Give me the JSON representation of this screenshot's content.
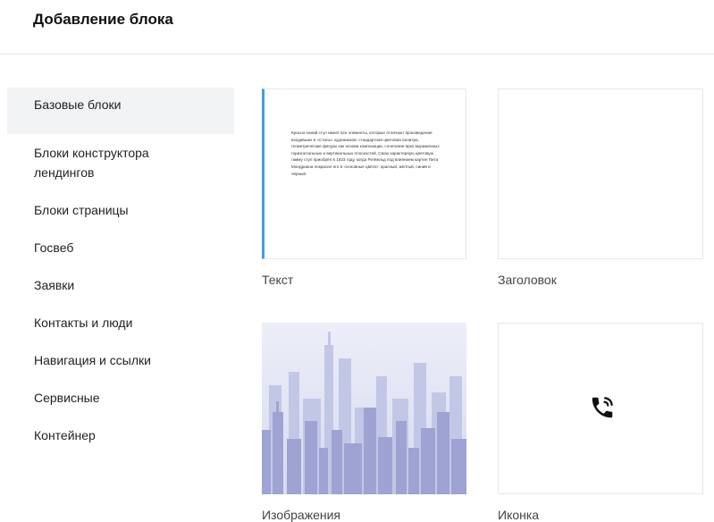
{
  "header": {
    "title": "Добавление блока"
  },
  "sidebar": {
    "items": [
      {
        "label": "Базовые блоки"
      },
      {
        "label": "Блоки конструктора лендингов"
      },
      {
        "label": "Блоки страницы"
      },
      {
        "label": "Госвеб"
      },
      {
        "label": "Заявки"
      },
      {
        "label": "Контакты и люди"
      },
      {
        "label": "Навигация и ссылки"
      },
      {
        "label": "Сервисные"
      },
      {
        "label": "Контейнер"
      }
    ]
  },
  "blocks": [
    {
      "label": "Текст",
      "preview": "Красно-синий стул имеет все элементы, которые отличают произведения входивших в «Стиль» художников: стандартная цветовая палитра, геометрические фигуры как основа композиции, сочетание ярко выраженных горизонтальных и вертикальных плоскостей. Свою характерную цветовую гамму стул приобрёл в 1923 году, когда Ритвельд под влиянием картин Пита Мондриана покрасил его в «основные цвета»: красный, жёлтый, синий и чёрный."
    },
    {
      "label": "Заголовок"
    },
    {
      "label": "Изображения"
    },
    {
      "label": "Иконка",
      "icon": "phone-call-icon"
    }
  ],
  "colors": {
    "accent": "#3fa0e0",
    "sidebar_active_bg": "#f2f3f5",
    "sky_top": "#e4e6f5",
    "buildings": "#9ea3d3"
  }
}
